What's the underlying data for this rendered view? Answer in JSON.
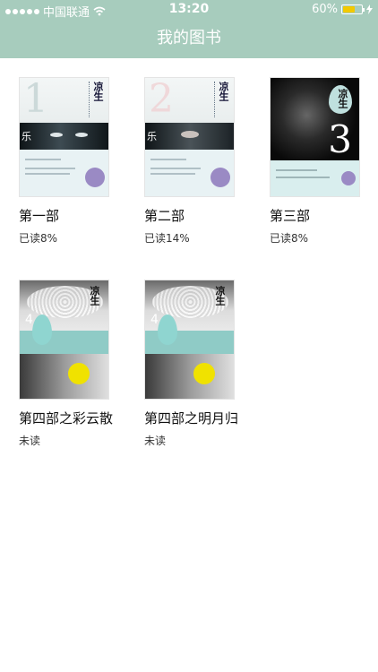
{
  "status_bar": {
    "carrier": "中国联通",
    "time": "13:20",
    "battery_text": "60%",
    "battery_level": 0.6,
    "wifi_icon": "wifi-icon",
    "charging_icon": "bolt-icon",
    "accent_color": "#a7ccbd",
    "battery_color": "#f2c900"
  },
  "navbar": {
    "title": "我的图书"
  },
  "books": [
    {
      "title": "第一部",
      "progress": "已读8%",
      "cover_number": "1",
      "cover_label": "乐"
    },
    {
      "title": "第二部",
      "progress": "已读14%",
      "cover_number": "2",
      "cover_label": "乐"
    },
    {
      "title": "第三部",
      "progress": "已读8%",
      "cover_number": "3"
    },
    {
      "title": "第四部之彩云散",
      "progress": "未读",
      "cover_number": "4"
    },
    {
      "title": "第四部之明月归",
      "progress": "未读",
      "cover_number": "4"
    }
  ],
  "cover_brand": "凉生"
}
